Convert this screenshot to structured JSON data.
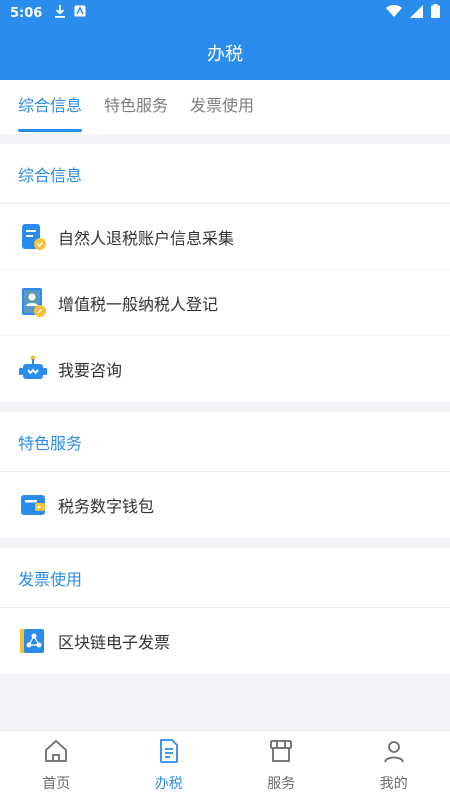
{
  "status_bar": {
    "time": "5:06"
  },
  "header": {
    "title": "办税"
  },
  "tabs": [
    {
      "label": "综合信息",
      "active": true
    },
    {
      "label": "特色服务",
      "active": false
    },
    {
      "label": "发票使用",
      "active": false
    }
  ],
  "sections": [
    {
      "title": "综合信息",
      "items": [
        {
          "label": "自然人退税账户信息采集",
          "icon": "id-card-icon"
        },
        {
          "label": "增值税一般纳税人登记",
          "icon": "registration-icon"
        },
        {
          "label": "我要咨询",
          "icon": "robot-icon"
        }
      ]
    },
    {
      "title": "特色服务",
      "items": [
        {
          "label": "税务数字钱包",
          "icon": "wallet-icon"
        }
      ]
    },
    {
      "title": "发票使用",
      "items": [
        {
          "label": "区块链电子发票",
          "icon": "blockchain-invoice-icon"
        }
      ]
    }
  ],
  "bottom_nav": [
    {
      "label": "首页",
      "icon": "home-icon",
      "active": false
    },
    {
      "label": "办税",
      "icon": "document-icon",
      "active": true
    },
    {
      "label": "服务",
      "icon": "store-icon",
      "active": false
    },
    {
      "label": "我的",
      "icon": "user-icon",
      "active": false
    }
  ],
  "colors": {
    "primary": "#2a8cec",
    "background": "#f3f4f7",
    "accent": "#f7c23a"
  }
}
